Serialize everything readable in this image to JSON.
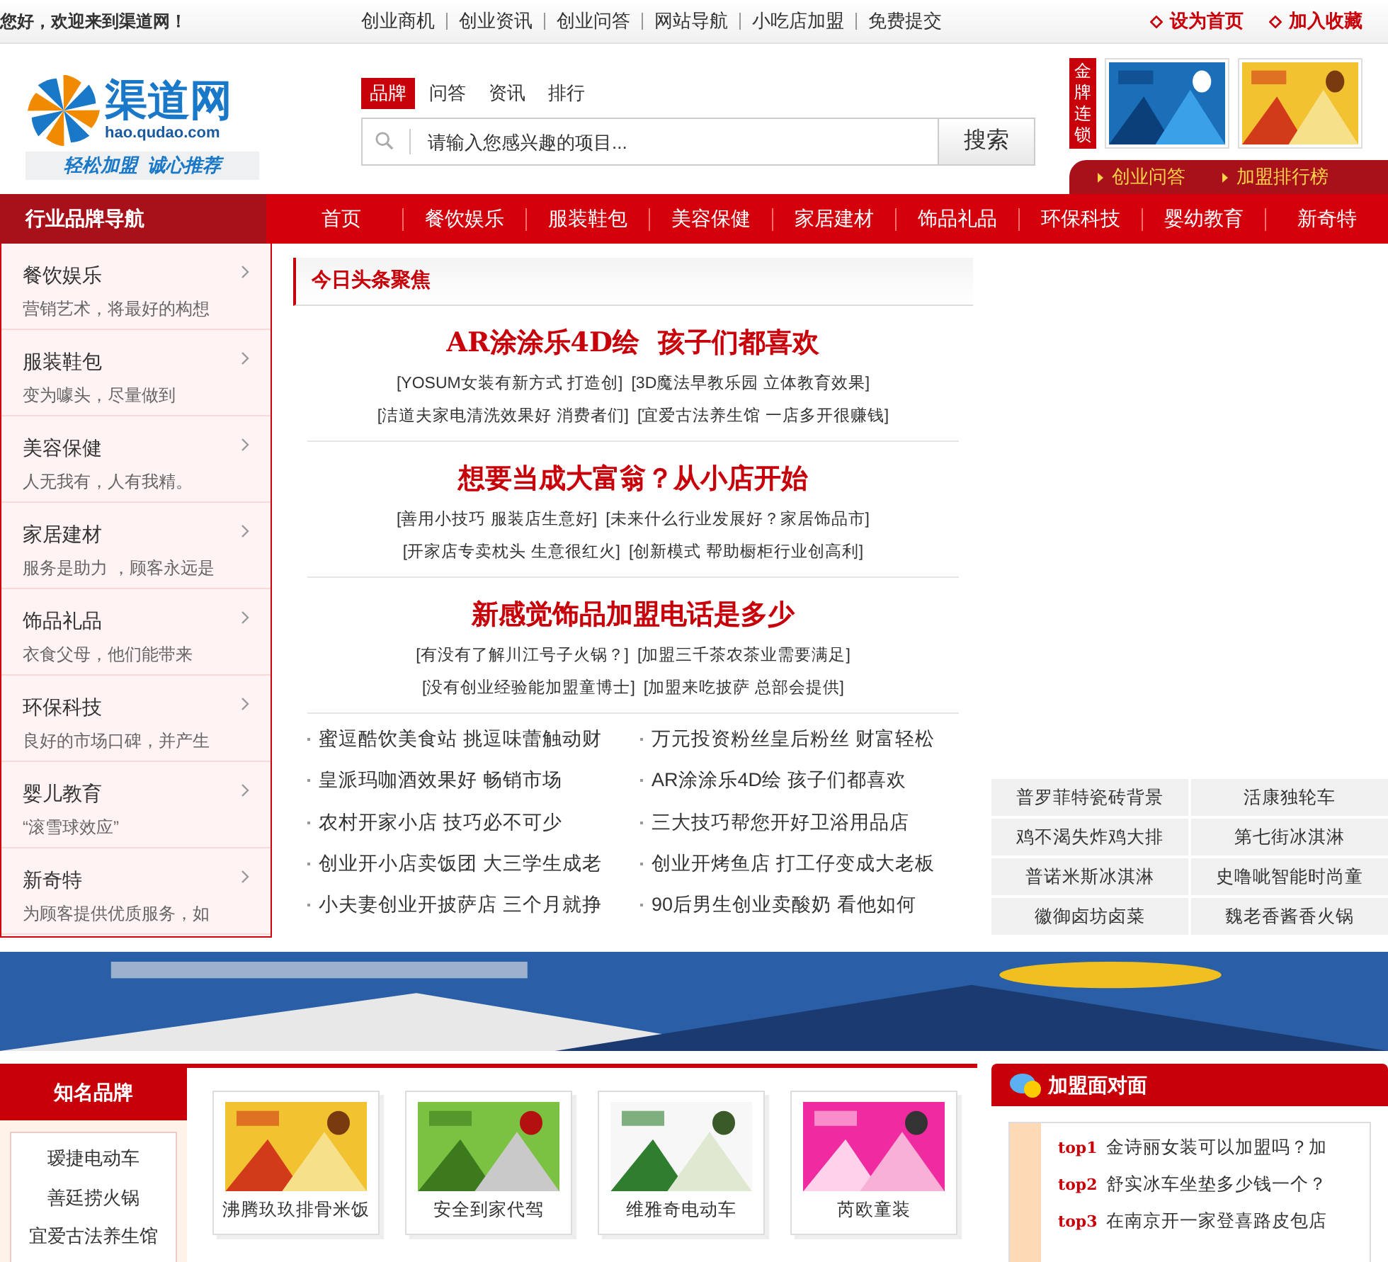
{
  "top_bar": {
    "greeting": "您好，欢迎来到渠道网！",
    "links": [
      "创业商机",
      "创业资讯",
      "创业问答",
      "网站导航",
      "小吃店加盟",
      "免费提交"
    ],
    "actions": [
      "设为首页",
      "加入收藏"
    ]
  },
  "header": {
    "logo": {
      "name": "渠道网",
      "domain": "hao.qudao.com",
      "slogan": "轻松加盟  诚心推荐"
    },
    "search_tabs": [
      {
        "label": "品牌",
        "selected": true
      },
      {
        "label": "问答",
        "selected": false
      },
      {
        "label": "资讯",
        "selected": false
      },
      {
        "label": "排行",
        "selected": false
      }
    ],
    "search": {
      "placeholder": "请输入您感兴趣的项目...",
      "button": "搜索"
    },
    "gold_badge": "金牌连锁",
    "quick_links": [
      "创业问答",
      "加盟排行榜"
    ]
  },
  "nav": {
    "title": "行业品牌导航",
    "items": [
      {
        "label": "首页",
        "selected": false
      },
      {
        "label": "餐饮娱乐",
        "selected": false
      },
      {
        "label": "服装鞋包",
        "selected": false
      },
      {
        "label": "美容保健",
        "selected": false
      },
      {
        "label": "家居建材",
        "selected": false
      },
      {
        "label": "饰品礼品",
        "selected": false
      },
      {
        "label": "环保科技",
        "selected": false
      },
      {
        "label": "婴幼教育",
        "selected": false
      },
      {
        "label": "新奇特",
        "selected": false
      }
    ]
  },
  "sidebar": {
    "items": [
      {
        "title": "餐饮娱乐",
        "subtitle": "营销艺术，将最好的构想"
      },
      {
        "title": "服装鞋包",
        "subtitle": "变为噱头，尽量做到"
      },
      {
        "title": "美容保健",
        "subtitle": "人无我有，人有我精。"
      },
      {
        "title": "家居建材",
        "subtitle": "服务是助力 ，顾客永远是"
      },
      {
        "title": "饰品礼品",
        "subtitle": "衣食父母，他们能带来"
      },
      {
        "title": "环保科技",
        "subtitle": "良好的市场口碑，并产生"
      },
      {
        "title": "婴儿教育",
        "subtitle": "“滚雪球效应”"
      },
      {
        "title": "新奇特",
        "subtitle": "为顾客提供优质服务，如"
      }
    ]
  },
  "headlines": {
    "title": "今日头条聚焦",
    "groups": [
      {
        "headline": "AR涂涂乐4D绘  孩子们都喜欢",
        "rows": [
          [
            "[YOSUM女装有新方式 打造创]",
            "[3D魔法早教乐园 立体教育效果]"
          ],
          [
            "[洁道夫家电清洗效果好 消费者们]",
            "[宜爱古法养生馆 一店多开很赚钱]"
          ]
        ]
      },
      {
        "headline": "想要当成大富翁？从小店开始",
        "rows": [
          [
            "[善用小技巧 服装店生意好]",
            "[未来什么行业发展好？家居饰品市]"
          ],
          [
            "[开家店专卖枕头 生意很红火]",
            "[创新模式 帮助橱柜行业创高利]"
          ]
        ]
      },
      {
        "headline": "新感觉饰品加盟电话是多少",
        "rows": [
          [
            "[有没有了解川江号子火锅？]",
            "[加盟三千茶农茶业需要满足]"
          ],
          [
            "[没有创业经验能加盟童博士]",
            "[加盟来吃披萨 总部会提供]"
          ]
        ]
      }
    ],
    "list": [
      "蜜逗酷饮美食站 挑逗味蕾触动财",
      "万元投资粉丝皇后粉丝 财富轻松",
      "皇派玛咖酒效果好 畅销市场",
      "AR涂涂乐4D绘 孩子们都喜欢",
      "农村开家小店 技巧必不可少",
      "三大技巧帮您开好卫浴用品店",
      "创业开小店卖饭团 大三学生成老",
      "创业开烤鱼店 打工仔变成大老板",
      "小夫妻创业开披萨店 三个月就挣",
      "90后男生创业卖酸奶 看他如何"
    ]
  },
  "tag_grid": [
    "普罗菲特瓷砖背景",
    "活康独轮车",
    "鸡不渴失炸鸡大排",
    "第七街冰淇淋",
    "普诺米斯冰淇淋",
    "史噜呲智能时尚童",
    "徽御卤坊卤菜",
    "魏老香酱香火锅"
  ],
  "famous_brands": {
    "title": "知名品牌",
    "items": [
      "瑷捷电动车",
      "善廷捞火锅",
      "宜爱古法养生馆"
    ],
    "cards": [
      "沸腾玖玖排骨米饭",
      "安全到家代驾",
      "维雅奇电动车",
      "芮欧童装"
    ]
  },
  "face_to_face": {
    "title": "加盟面对面",
    "items": [
      {
        "rank": "top1",
        "text": "金诗丽女装可以加盟吗？加"
      },
      {
        "rank": "top2",
        "text": "舒实冰车坐垫多少钱一个？"
      },
      {
        "rank": "top3",
        "text": "在南京开一家登喜路皮包店"
      }
    ]
  }
}
